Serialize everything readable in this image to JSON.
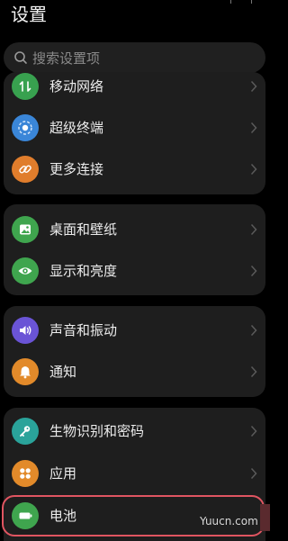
{
  "header": {
    "title": "设置"
  },
  "search": {
    "placeholder": "搜索设置项"
  },
  "groups": [
    {
      "items": [
        {
          "label": "移动网络",
          "icon": "mobile-network-icon",
          "color": "#38a14f"
        },
        {
          "label": "超级终端",
          "icon": "super-device-icon",
          "color": "#3a86d8"
        },
        {
          "label": "更多连接",
          "icon": "link-icon",
          "color": "#e07d2c"
        }
      ]
    },
    {
      "items": [
        {
          "label": "桌面和壁纸",
          "icon": "wallpaper-icon",
          "color": "#3fa54e"
        },
        {
          "label": "显示和亮度",
          "icon": "eye-icon",
          "color": "#3fa54e"
        }
      ]
    },
    {
      "items": [
        {
          "label": "声音和振动",
          "icon": "speaker-icon",
          "color": "#6a54d6"
        },
        {
          "label": "通知",
          "icon": "bell-icon",
          "color": "#e28a2a"
        }
      ]
    },
    {
      "items": [
        {
          "label": "生物识别和密码",
          "icon": "key-icon",
          "color": "#2aa39a"
        },
        {
          "label": "应用",
          "icon": "apps-icon",
          "color": "#e28a2a"
        },
        {
          "label": "电池",
          "icon": "battery-icon",
          "color": "#3fa54e"
        }
      ]
    }
  ],
  "watermark": {
    "text": "Yuucn.com"
  },
  "colors": {
    "background": "#000000",
    "card": "#1e1e1e",
    "highlight": "#e05561"
  }
}
